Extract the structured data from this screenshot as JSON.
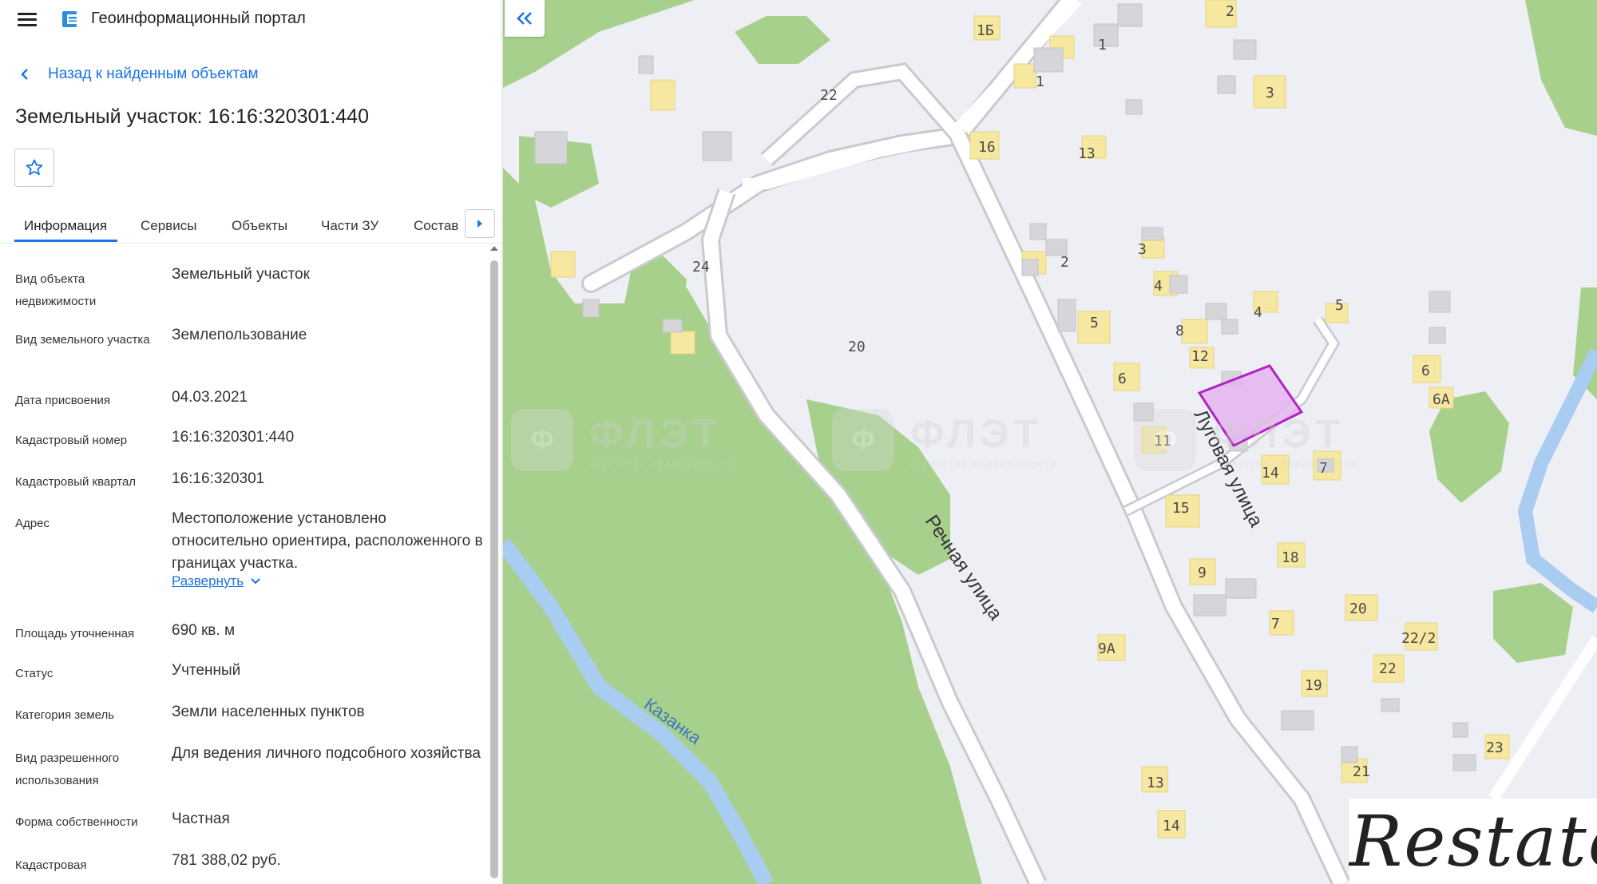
{
  "app": {
    "title": "Геоинформационный портал",
    "menu_icon": "menu-icon",
    "logo_icon": "portal-logo-icon"
  },
  "nav": {
    "back_label": "Назад к найденным объектам"
  },
  "object": {
    "title": "Земельный участок: 16:16:320301:440"
  },
  "tabs": [
    {
      "label": "Информация",
      "active": true
    },
    {
      "label": "Сервисы"
    },
    {
      "label": "Объекты"
    },
    {
      "label": "Части ЗУ"
    },
    {
      "label": "Состав"
    }
  ],
  "info": {
    "rows": [
      {
        "label": "Вид объекта недвижимости",
        "value": "Земельный участок"
      },
      {
        "label": "Вид земельного участка",
        "value": "Землепользование"
      },
      {
        "label": "Дата присвоения",
        "value": "04.03.2021"
      },
      {
        "label": "Кадастровый номер",
        "value": "16:16:320301:440"
      },
      {
        "label": "Кадастровый квартал",
        "value": "16:16:320301"
      },
      {
        "label": "Адрес",
        "value": "Местоположение установлено относительно ориентира, расположенного в границах участка."
      },
      {
        "label": "Площадь уточненная",
        "value": "690 кв. м"
      },
      {
        "label": "Статус",
        "value": "Учтенный"
      },
      {
        "label": "Категория земель",
        "value": "Земли населенных пунктов"
      },
      {
        "label": "Вид разрешенного использования",
        "value": "Для ведения личного подсобного хозяйства"
      },
      {
        "label": "Форма собственности",
        "value": "Частная"
      },
      {
        "label": "Кадастровая",
        "value": "781 388,02 руб."
      }
    ],
    "expand_label": "Развернуть"
  },
  "map": {
    "streets": [
      "Луговая улица",
      "Речная улица"
    ],
    "river": "Казанка",
    "house_numbers": [
      "1Б",
      "2",
      "1",
      "1",
      "22",
      "3",
      "16",
      "16",
      "13",
      "24",
      "3",
      "2",
      "4",
      "5",
      "20",
      "5",
      "8",
      "12",
      "6",
      "4",
      "6",
      "6А",
      "11",
      "14",
      "7",
      "15",
      "18",
      "9",
      "7",
      "20",
      "22/2",
      "9А",
      "22",
      "19",
      "21",
      "23",
      "13",
      "14"
    ],
    "watermark": {
      "text": "ФЛЭТ",
      "sub": "агентство недвижимости",
      "mark": "Ф"
    },
    "brand": "Restate",
    "colors": {
      "forest": "#a8d08d",
      "river": "#a9cdf0",
      "house": "#f6e7a1",
      "road": "#ffffff",
      "parcel": "#b025c4",
      "background": "#eeeff5"
    }
  }
}
